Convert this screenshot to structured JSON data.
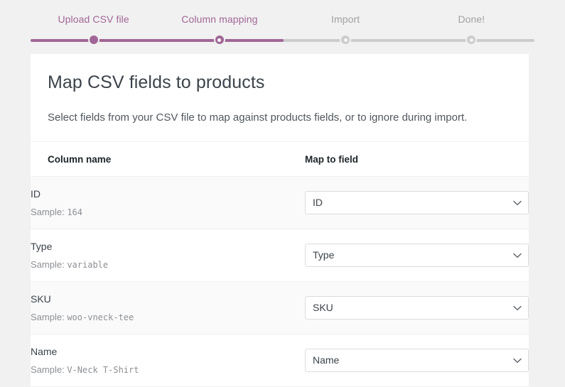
{
  "stepper": {
    "steps": [
      {
        "label": "Upload CSV file",
        "state": "done"
      },
      {
        "label": "Column mapping",
        "state": "active"
      },
      {
        "label": "Import",
        "state": "pending"
      },
      {
        "label": "Done!",
        "state": "pending"
      }
    ],
    "accent_color": "#a16696",
    "inactive_color": "#cccccc",
    "progress_percent": 50
  },
  "card": {
    "title": "Map CSV fields to products",
    "description": "Select fields from your CSV file to map against products fields, or to ignore during import."
  },
  "table": {
    "headers": {
      "column_name": "Column name",
      "map_to_field": "Map to field"
    },
    "sample_prefix": "Sample:",
    "rows": [
      {
        "name": "ID",
        "sample": "164",
        "mapped": "ID"
      },
      {
        "name": "Type",
        "sample": "variable",
        "mapped": "Type"
      },
      {
        "name": "SKU",
        "sample": "woo-vneck-tee",
        "mapped": "SKU"
      },
      {
        "name": "Name",
        "sample": "V-Neck T-Shirt",
        "mapped": "Name"
      }
    ]
  }
}
